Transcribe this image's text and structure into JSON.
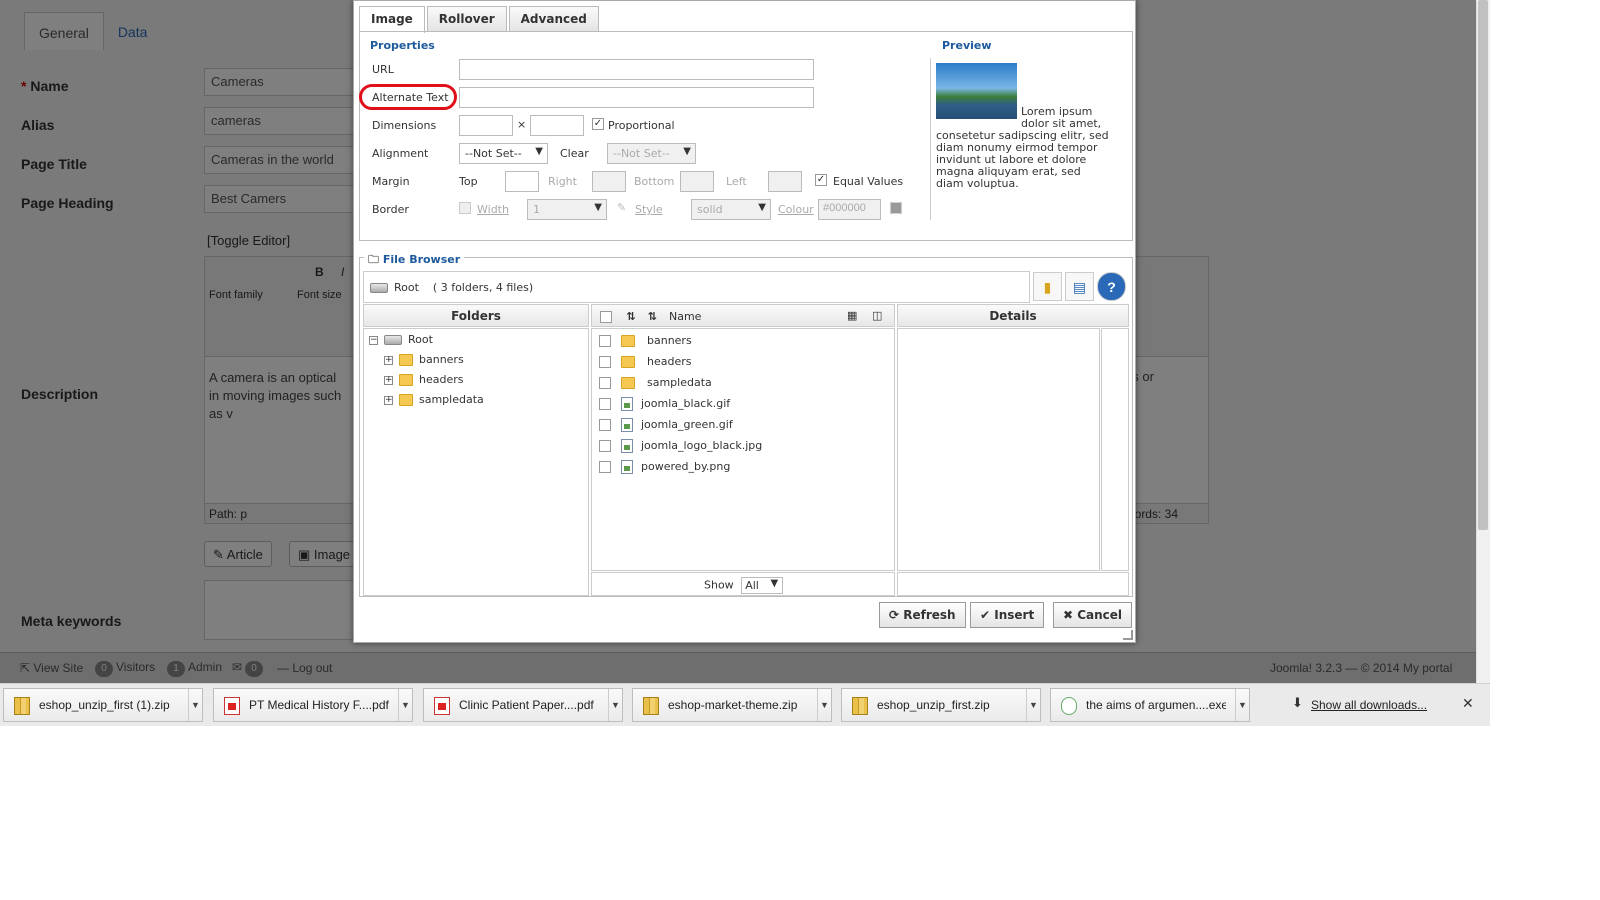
{
  "background": {
    "tabs": [
      "General",
      "Data"
    ],
    "fields": [
      {
        "label": "Name",
        "required": true,
        "value": "Cameras"
      },
      {
        "label": "Alias",
        "value": "cameras"
      },
      {
        "label": "Page Title",
        "value": "Cameras in the world"
      },
      {
        "label": "Page Heading",
        "value": "Best Camers"
      }
    ],
    "toggle_editor": "[Toggle Editor]",
    "editor_font_family": "Font family",
    "editor_font_size": "Font size",
    "description_label": "Description",
    "description_text": "A camera is an optical in moving images such as v",
    "description_text_right": "ns or",
    "path": "Path:  p",
    "words": "ords: 34",
    "article_button": "Article",
    "image_button": "Image",
    "meta_keywords_label": "Meta keywords",
    "status": {
      "view_site": "View Site",
      "visitors_count": "0",
      "visitors_label": "Visitors",
      "admin_count": "1",
      "admin_label": "Admin",
      "messages_count": "0",
      "logout": "Log out",
      "footer": "Joomla! 3.2.3  —  © 2014 My portal"
    }
  },
  "dialog": {
    "tabs": [
      "Image",
      "Rollover",
      "Advanced"
    ],
    "properties_title": "Properties",
    "preview_title": "Preview",
    "url_label": "URL",
    "alt_label": "Alternate Text",
    "dimensions_label": "Dimensions",
    "times": "×",
    "proportional_label": "Proportional",
    "alignment_label": "Alignment",
    "alignment_value": "--Not Set--",
    "clear_label": "Clear",
    "clear_value": "--Not Set--",
    "margin_label": "Margin",
    "margin_top": "Top",
    "margin_right": "Right",
    "margin_bottom": "Bottom",
    "margin_left": "Left",
    "equal_values_label": "Equal Values",
    "border_label": "Border",
    "border_width_label": "Width",
    "border_width_value": "1",
    "border_style_label": "Style",
    "border_style_value": "solid",
    "border_colour_label": "Colour",
    "border_colour_value": "#000000",
    "preview_text": "Lorem ipsum dolor sit amet, consetetur sadipscing elitr, sed diam nonumy eirmod tempor invidunt ut labore et dolore magna aliquyam erat, sed diam voluptua.",
    "file_browser": {
      "title": "File Browser",
      "root_label": "Root",
      "root_summary": "( 3 folders, 4 files)",
      "folders_header": "Folders",
      "name_header": "Name",
      "details_header": "Details",
      "tree": [
        "banners",
        "headers",
        "sampledata"
      ],
      "items": [
        {
          "name": "banners",
          "type": "folder"
        },
        {
          "name": "headers",
          "type": "folder"
        },
        {
          "name": "sampledata",
          "type": "folder"
        },
        {
          "name": "joomla_black.gif",
          "type": "file"
        },
        {
          "name": "joomla_green.gif",
          "type": "file"
        },
        {
          "name": "joomla_logo_black.jpg",
          "type": "file"
        },
        {
          "name": "powered_by.png",
          "type": "file"
        }
      ],
      "show_label": "Show",
      "show_value": "All"
    },
    "buttons": {
      "refresh": "Refresh",
      "insert": "Insert",
      "cancel": "Cancel"
    }
  },
  "downloads": {
    "items": [
      {
        "name": "eshop_unzip_first (1).zip",
        "type": "zip"
      },
      {
        "name": "PT Medical History F....pdf",
        "type": "pdf"
      },
      {
        "name": "Clinic Patient Paper....pdf",
        "type": "pdf"
      },
      {
        "name": "eshop-market-theme.zip",
        "type": "zip"
      },
      {
        "name": "eshop_unzip_first.zip",
        "type": "zip"
      },
      {
        "name": "the aims of argumen....exe",
        "type": "exe"
      }
    ],
    "show_all": "Show all downloads..."
  },
  "colors": {
    "accent": "#1c5a9c",
    "highlight": "#e0101a"
  }
}
